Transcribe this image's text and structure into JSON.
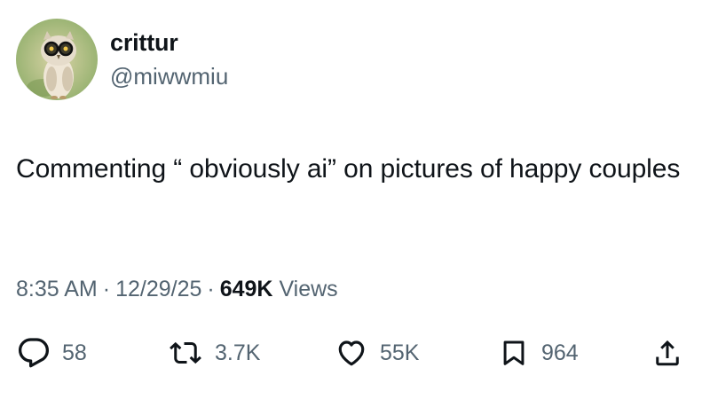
{
  "user": {
    "display_name": "crittur",
    "handle": "@miwwmiu",
    "avatar_icon": "owl-with-glasses-avatar"
  },
  "tweet": {
    "text": "Commenting “ obviously ai” on pictures of happy couples"
  },
  "meta": {
    "time": "8:35 AM",
    "separator": "·",
    "date": "12/29/25",
    "views_count": "649K",
    "views_label": "Views"
  },
  "actions": {
    "reply": {
      "icon": "reply-icon",
      "count": "58"
    },
    "retweet": {
      "icon": "retweet-icon",
      "count": "3.7K"
    },
    "like": {
      "icon": "heart-icon",
      "count": "55K"
    },
    "bookmark": {
      "icon": "bookmark-icon",
      "count": "964"
    },
    "share": {
      "icon": "share-icon"
    }
  },
  "colors": {
    "text_primary": "#0f1419",
    "text_secondary": "#536471",
    "background": "#ffffff"
  }
}
